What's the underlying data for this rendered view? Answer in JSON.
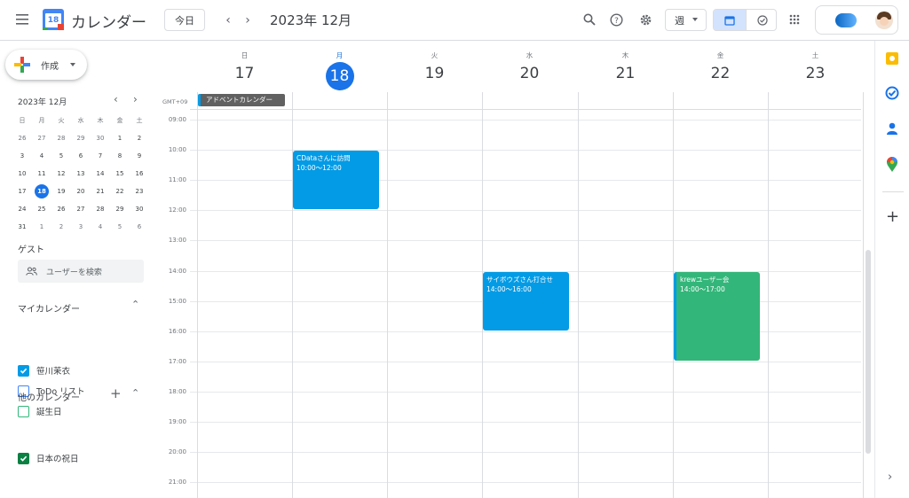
{
  "header": {
    "app_title": "カレンダー",
    "logo_day": "18",
    "today_label": "今日",
    "current_range": "2023年 12月",
    "view_label": "週"
  },
  "sidebar": {
    "create_label": "作成",
    "mini_cal": {
      "title": "2023年 12月",
      "weekdays": [
        "日",
        "月",
        "火",
        "水",
        "木",
        "金",
        "土"
      ],
      "weeks": [
        [
          "26",
          "27",
          "28",
          "29",
          "30",
          "1",
          "2"
        ],
        [
          "3",
          "4",
          "5",
          "6",
          "7",
          "8",
          "9"
        ],
        [
          "10",
          "11",
          "12",
          "13",
          "14",
          "15",
          "16"
        ],
        [
          "17",
          "18",
          "19",
          "20",
          "21",
          "22",
          "23"
        ],
        [
          "24",
          "25",
          "26",
          "27",
          "28",
          "29",
          "30"
        ],
        [
          "31",
          "1",
          "2",
          "3",
          "4",
          "5",
          "6"
        ]
      ],
      "selected": "18"
    },
    "guest_title": "ゲスト",
    "guest_search_placeholder": "ユーザーを検索",
    "my_calendars_title": "マイカレンダー",
    "my_calendars": [
      {
        "label": "笹川茉衣",
        "checked": true,
        "color": "#039be5"
      },
      {
        "label": "ToDo リスト",
        "checked": false,
        "color": "#4285f4"
      },
      {
        "label": "誕生日",
        "checked": false,
        "color": "#33b679"
      }
    ],
    "other_calendars_title": "他のカレンダー",
    "other_calendars": [
      {
        "label": "日本の祝日",
        "checked": true,
        "color": "#0b8043"
      }
    ]
  },
  "week": {
    "timezone": "GMT+09",
    "days": [
      {
        "dow": "日",
        "num": "17",
        "today": false
      },
      {
        "dow": "月",
        "num": "18",
        "today": true
      },
      {
        "dow": "火",
        "num": "19",
        "today": false
      },
      {
        "dow": "水",
        "num": "20",
        "today": false
      },
      {
        "dow": "木",
        "num": "21",
        "today": false
      },
      {
        "dow": "金",
        "num": "22",
        "today": false
      },
      {
        "dow": "土",
        "num": "23",
        "today": false
      }
    ],
    "all_day_event": "アドベントカレンダー",
    "hours": [
      "09:00",
      "10:00",
      "11:00",
      "12:00",
      "13:00",
      "14:00",
      "15:00",
      "16:00",
      "17:00",
      "18:00",
      "19:00",
      "20:00",
      "21:00"
    ],
    "events": [
      {
        "title": "CDataさんに訪問",
        "time": "10:00～12:00",
        "day": 1,
        "start": 10,
        "end": 12,
        "color": "#039be5"
      },
      {
        "title": "サイボウズさん打合せ",
        "time": "14:00～16:00",
        "day": 3,
        "start": 14,
        "end": 16,
        "color": "#039be5"
      },
      {
        "title": "krewユーザー会",
        "time": "14:00～17:00",
        "day": 5,
        "start": 14,
        "end": 17,
        "color": "#33b679"
      }
    ]
  },
  "colors": {
    "accent": "#1a73e8",
    "event_blue": "#039be5",
    "event_green": "#33b679"
  }
}
